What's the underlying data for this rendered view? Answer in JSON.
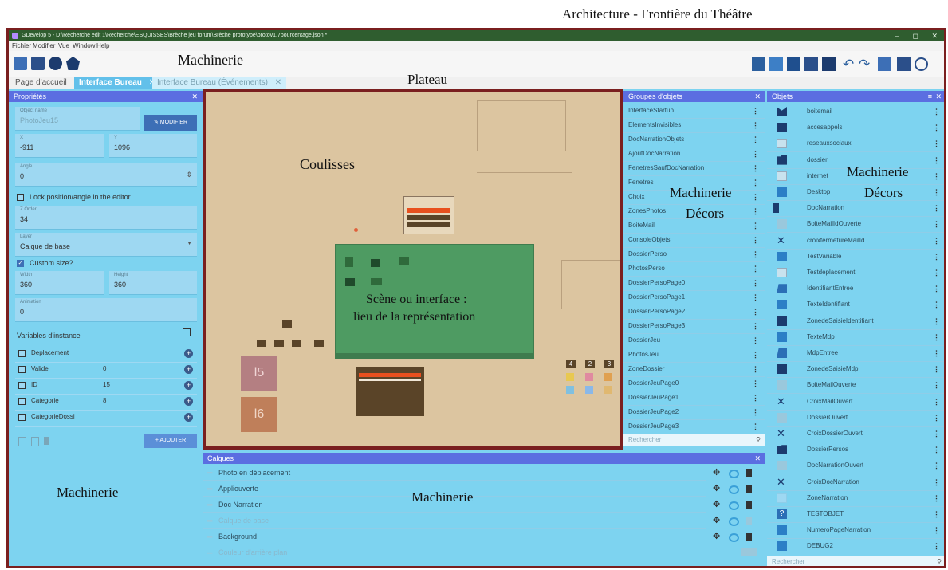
{
  "annotations": {
    "architecture_title": "Architecture - Frontière du Théâtre",
    "machinerie_toolbar": "Machinerie",
    "plateau": "Plateau",
    "coulisses": "Coulisses",
    "scene_line1": "Scène ou interface :",
    "scene_line2": "lieu de la représentation",
    "machinerie_decors_groups_a": "Machinerie",
    "machinerie_decors_groups_b": "Décors",
    "machinerie_decors_objects_a": "Machinerie",
    "machinerie_decors_objects_b": "Décors",
    "machinerie_left": "Machinerie",
    "machinerie_bottom": "Machinerie"
  },
  "window": {
    "title": "GDevelop 5 - D:\\Recherche edit 1\\Recherche\\ESQUISSES\\Brèche jeu forum\\Brèche prototype\\protov1.7pourcentage.json *",
    "controls": [
      "–",
      "◻",
      "✕"
    ]
  },
  "menu": [
    "Fichier",
    "Modifier",
    "Vue",
    "Window",
    "Help"
  ],
  "tabs": [
    {
      "label": "Page d'accueil",
      "active": false,
      "closable": false
    },
    {
      "label": "Interface Bureau",
      "active": true,
      "closable": true
    },
    {
      "label": "Interface Bureau (Événements)",
      "active": false,
      "closable": true
    }
  ],
  "properties": {
    "header": "Propriétés",
    "object_name_label": "Object name",
    "object_name_value": "PhotoJeu15",
    "modify_button": "MODIFIER",
    "x_label": "X",
    "x_value": "-911",
    "y_label": "Y",
    "y_value": "1096",
    "angle_label": "Angle",
    "angle_value": "0",
    "lock_label": "Lock position/angle in the editor",
    "zorder_label": "Z Order",
    "zorder_value": "34",
    "layer_label": "Layer",
    "layer_value": "Calque de base",
    "custom_size_label": "Custom size?",
    "width_label": "Width",
    "width_value": "360",
    "height_label": "Height",
    "height_value": "360",
    "animation_label": "Animation",
    "animation_value": "0",
    "variables_title": "Variables d'instance",
    "variables": [
      {
        "name": "Deplacement",
        "value": ""
      },
      {
        "name": "Valide",
        "value": "0"
      },
      {
        "name": "ID",
        "value": "15"
      },
      {
        "name": "Categorie",
        "value": "8"
      },
      {
        "name": "CategorieDossi",
        "value": ""
      }
    ],
    "add_button": "+ AJOUTER"
  },
  "groups": {
    "header": "Groupes d'objets",
    "items": [
      "InterfaceStartup",
      "ElementsInvisibles",
      "DocNarrationObjets",
      "AjoutDocNarration",
      "FenetresSaufDocNarration",
      "Fenetres",
      "Choix",
      "ZonesPhotos",
      "BoiteMail",
      "ConsoleObjets",
      "DossierPerso",
      "PhotosPerso",
      "DossierPersoPage0",
      "DossierPersoPage1",
      "DossierPersoPage2",
      "DossierPersoPage3",
      "DossierJeu",
      "PhotosJeu",
      "ZoneDossier",
      "DossierJeuPage0",
      "DossierJeuPage1",
      "DossierJeuPage2",
      "DossierJeuPage3"
    ],
    "search_placeholder": "Rechercher"
  },
  "objects": {
    "header": "Objets",
    "items": [
      {
        "name": "boitemail",
        "icon": "mail-icon"
      },
      {
        "name": "accesappels",
        "icon": "square-icon"
      },
      {
        "name": "reseauxsociaux",
        "icon": "image-icon"
      },
      {
        "name": "dossier",
        "icon": "folder-icon"
      },
      {
        "name": "internet",
        "icon": "image-icon"
      },
      {
        "name": "Desktop",
        "icon": "text-icon"
      },
      {
        "name": "DocNarration",
        "icon": "doc-icon"
      },
      {
        "name": "BoiteMailIdOuverte",
        "icon": "panel-icon"
      },
      {
        "name": "croixfermetureMailId",
        "icon": "cross-icon"
      },
      {
        "name": "TestVariable",
        "icon": "text-icon"
      },
      {
        "name": "Testdeplacement",
        "icon": "image-icon"
      },
      {
        "name": "IdentifiantEntree",
        "icon": "input-icon"
      },
      {
        "name": "TexteIdentifiant",
        "icon": "text-icon"
      },
      {
        "name": "ZonedeSaisieIdentifiant",
        "icon": "square-icon"
      },
      {
        "name": "TexteMdp",
        "icon": "text-icon"
      },
      {
        "name": "MdpEntree",
        "icon": "input-icon"
      },
      {
        "name": "ZonedeSaisieMdp",
        "icon": "square-icon"
      },
      {
        "name": "BoiteMailOuverte",
        "icon": "panel-icon"
      },
      {
        "name": "CroixMailOuvert",
        "icon": "cross-icon"
      },
      {
        "name": "DossierOuvert",
        "icon": "panel-icon"
      },
      {
        "name": "CroixDossierOuvert",
        "icon": "cross-icon"
      },
      {
        "name": "DossierPersos",
        "icon": "folder-icon"
      },
      {
        "name": "DocNarrationOuvert",
        "icon": "panel-icon"
      },
      {
        "name": "CroixDocNarration",
        "icon": "cross-icon"
      },
      {
        "name": "ZoneNarration",
        "icon": "empty-icon"
      },
      {
        "name": "TESTOBJET",
        "icon": "question-icon"
      },
      {
        "name": "NumeroPageNarration",
        "icon": "text-icon"
      },
      {
        "name": "DEBUG2",
        "icon": "text-icon"
      }
    ],
    "search_placeholder": "Rechercher"
  },
  "layers": {
    "header": "Calques",
    "items": [
      {
        "name": "Photo en déplacement",
        "dim": false
      },
      {
        "name": "Appliouverte",
        "dim": false
      },
      {
        "name": "Doc Narration",
        "dim": false
      },
      {
        "name": "Calque de base",
        "dim": true
      },
      {
        "name": "Background",
        "dim": false
      },
      {
        "name": "Couleur d'arrière plan",
        "dim": true
      }
    ]
  },
  "canvas": {
    "photo_labels": [
      "l5",
      "l6"
    ],
    "tile_labels": [
      "4",
      "2",
      "3"
    ]
  },
  "colors": {
    "window_border": "#7a1f1f",
    "panel_header": "#5b6ee1",
    "panel_bg": "#7dd3f0",
    "canvas_bg": "#dcc5a0",
    "scene_green": "#4e9b62"
  }
}
